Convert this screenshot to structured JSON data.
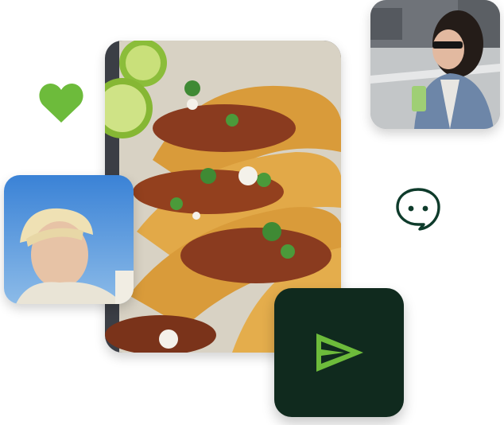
{
  "images": {
    "tacos": {
      "alt": ""
    },
    "woman": {
      "alt": ""
    },
    "man": {
      "alt": ""
    }
  },
  "icons": {
    "heart": "heart-icon",
    "chat": "chat-bubble-icon",
    "send": "send-icon"
  },
  "colors": {
    "heart": "#6dbb3b",
    "chat_stroke": "#0e3b2b",
    "send_tile_bg": "#102a1e",
    "send_arrow": "#6dbb3b"
  }
}
